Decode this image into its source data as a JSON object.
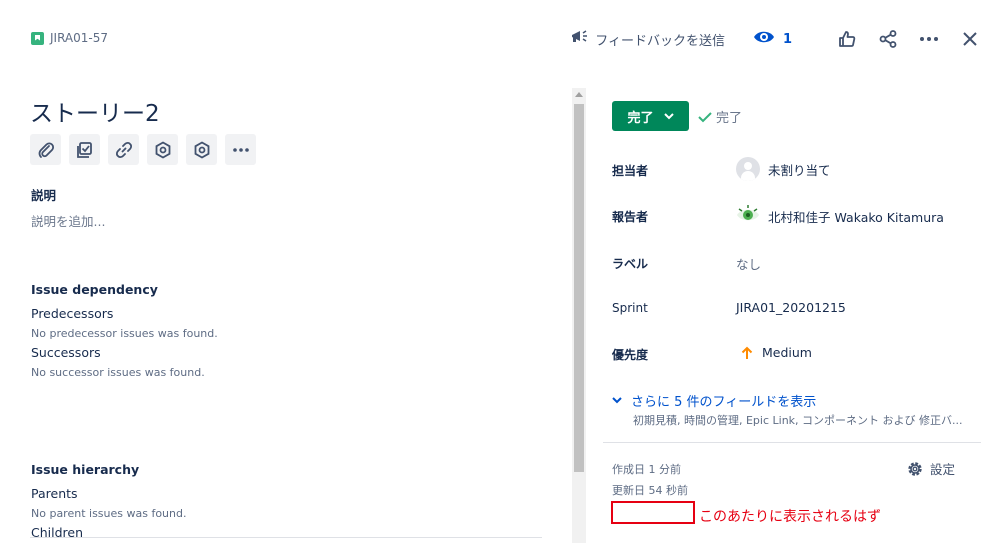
{
  "header": {
    "issue_key": "JIRA01-57",
    "feedback_label": "フィードバックを送信",
    "watch_count": "1"
  },
  "issue": {
    "title": "ストーリー2"
  },
  "description": {
    "label": "説明",
    "placeholder": "説明を追加..."
  },
  "dependency": {
    "title": "Issue dependency",
    "predecessors_label": "Predecessors",
    "predecessors_empty": "No predecessor issues was found.",
    "successors_label": "Successors",
    "successors_empty": "No successor issues was found."
  },
  "hierarchy": {
    "title": "Issue hierarchy",
    "parents_label": "Parents",
    "parents_empty": "No parent issues was found.",
    "children_label": "Children"
  },
  "status": {
    "button_label": "完了",
    "resolution_label": "完了"
  },
  "fields": {
    "assignee_label": "担当者",
    "assignee_value": "未割り当て",
    "reporter_label": "報告者",
    "reporter_value": "北村和佳子 Wakako Kitamura",
    "labels_label": "ラベル",
    "labels_value": "なし",
    "sprint_label": "Sprint",
    "sprint_value": "JIRA01_20201215",
    "priority_label": "優先度",
    "priority_value": "Medium"
  },
  "more_fields": {
    "label": "さらに 5 件のフィールドを表示",
    "sublabel": "初期見積, 時間の管理, Epic Link, コンポーネント および 修正バ..."
  },
  "meta": {
    "created": "作成日 1 分前",
    "updated": "更新日 54 秒前",
    "settings_label": "設定"
  },
  "annotation": {
    "note": "このあたりに表示されるはず"
  },
  "colors": {
    "status_green": "#00875a",
    "link_blue": "#0052cc",
    "annotation_red": "#e60012",
    "story_green": "#36b37e",
    "priority_orange": "#ff8b00"
  }
}
